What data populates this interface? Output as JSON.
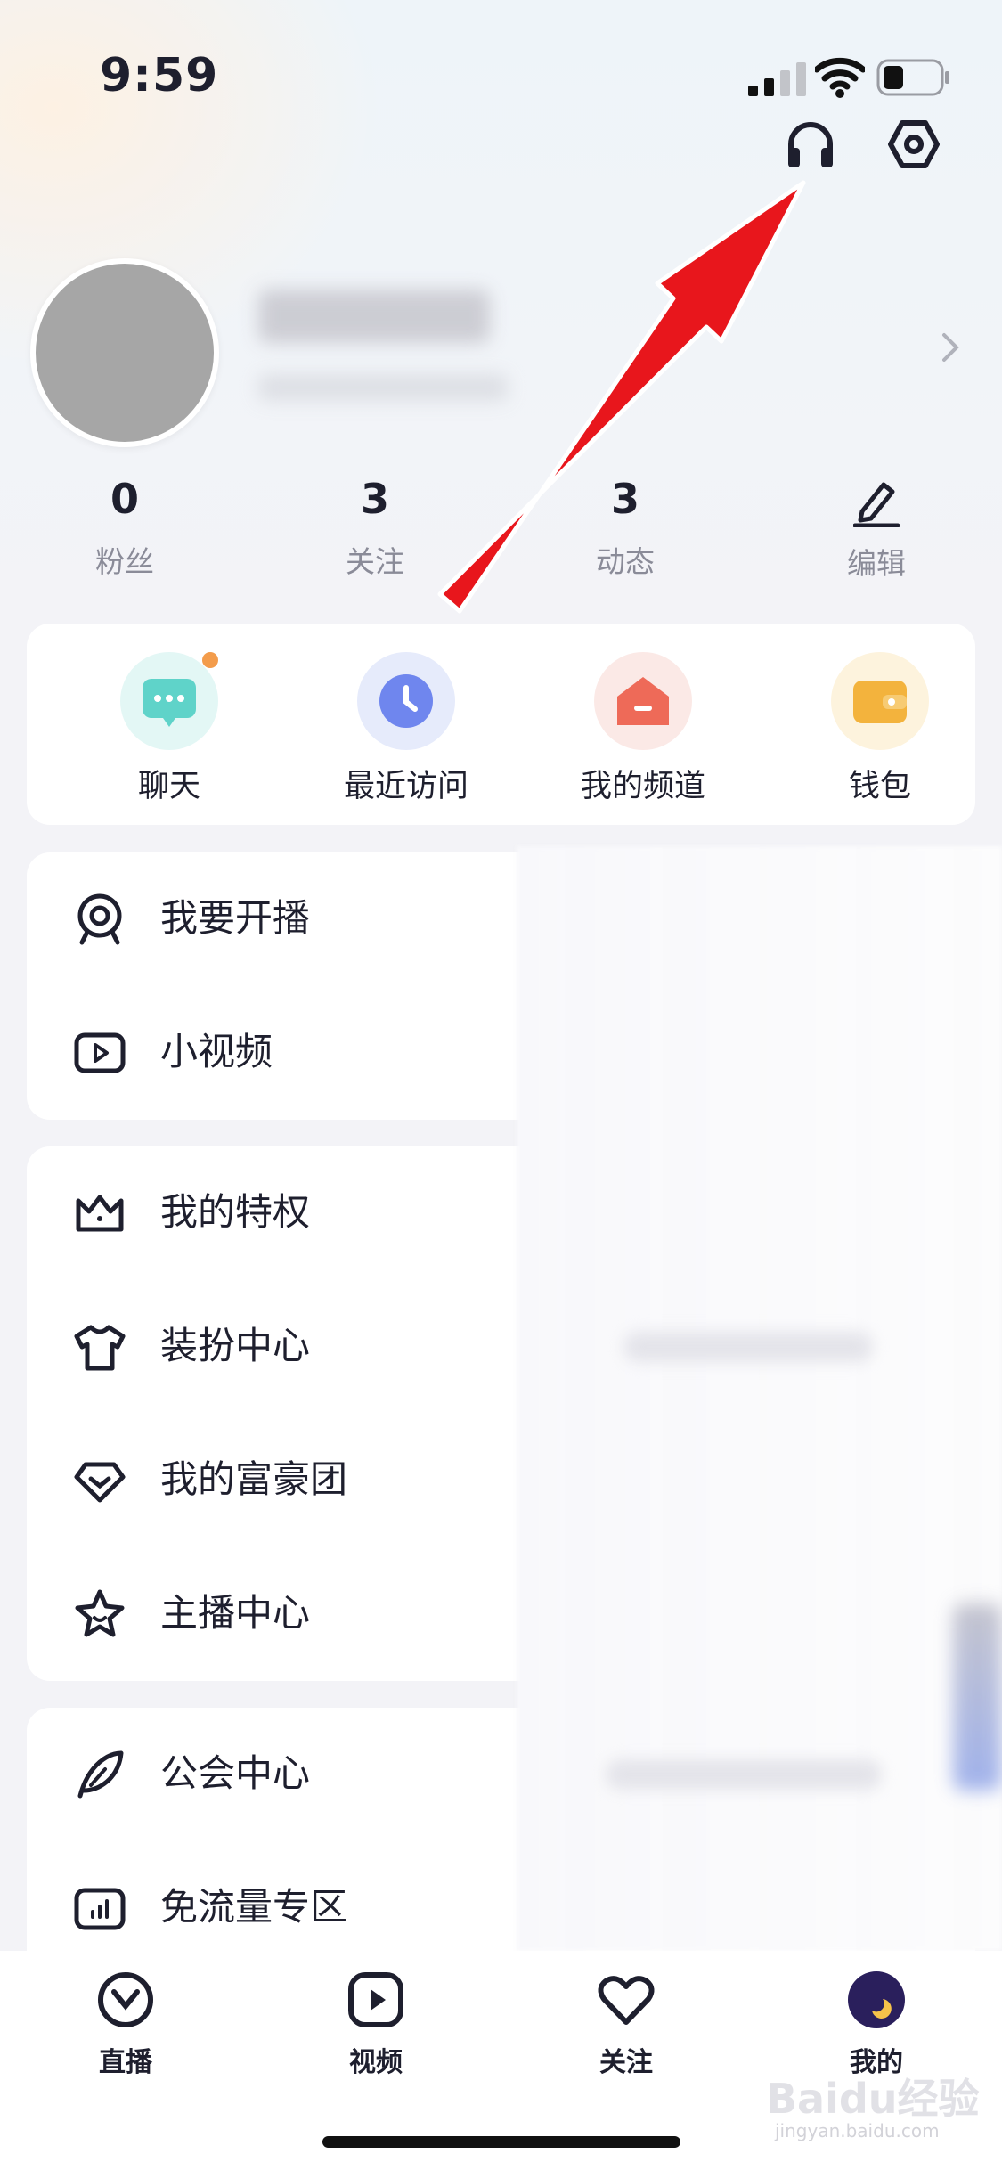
{
  "status_bar": {
    "time": "9:59"
  },
  "profile": {
    "stats": [
      {
        "value": "0",
        "label": "粉丝"
      },
      {
        "value": "3",
        "label": "关注"
      },
      {
        "value": "3",
        "label": "动态"
      }
    ],
    "edit_label": "编辑"
  },
  "quick_actions": [
    {
      "label": "聊天",
      "icon": "chat-icon",
      "color": "#5fd3c9"
    },
    {
      "label": "最近访问",
      "icon": "clock-icon",
      "color": "#6f86ee"
    },
    {
      "label": "我的频道",
      "icon": "home-icon",
      "color": "#ee6a58"
    },
    {
      "label": "钱包",
      "icon": "wallet-icon",
      "color": "#f3b33d"
    }
  ],
  "menu_groups": [
    {
      "items": [
        {
          "label": "我要开播",
          "icon": "webcam-icon"
        },
        {
          "label": "小视频",
          "icon": "video-icon"
        }
      ]
    },
    {
      "items": [
        {
          "label": "我的特权",
          "icon": "crown-icon"
        },
        {
          "label": "装扮中心",
          "icon": "shirt-icon"
        },
        {
          "label": "我的富豪团",
          "icon": "diamond-icon"
        },
        {
          "label": "主播中心",
          "icon": "star-icon"
        }
      ]
    },
    {
      "items": [
        {
          "label": "公会中心",
          "icon": "feather-icon"
        },
        {
          "label": "免流量专区",
          "icon": "data-chart-icon"
        }
      ]
    }
  ],
  "tab_bar": [
    {
      "label": "直播",
      "icon": "live-icon"
    },
    {
      "label": "视频",
      "icon": "play-icon"
    },
    {
      "label": "关注",
      "icon": "heart-icon"
    },
    {
      "label": "我的",
      "icon": "moon-avatar-icon"
    }
  ],
  "watermark": {
    "text": "Baidu经验",
    "sub": "jingyan.baidu.com"
  }
}
